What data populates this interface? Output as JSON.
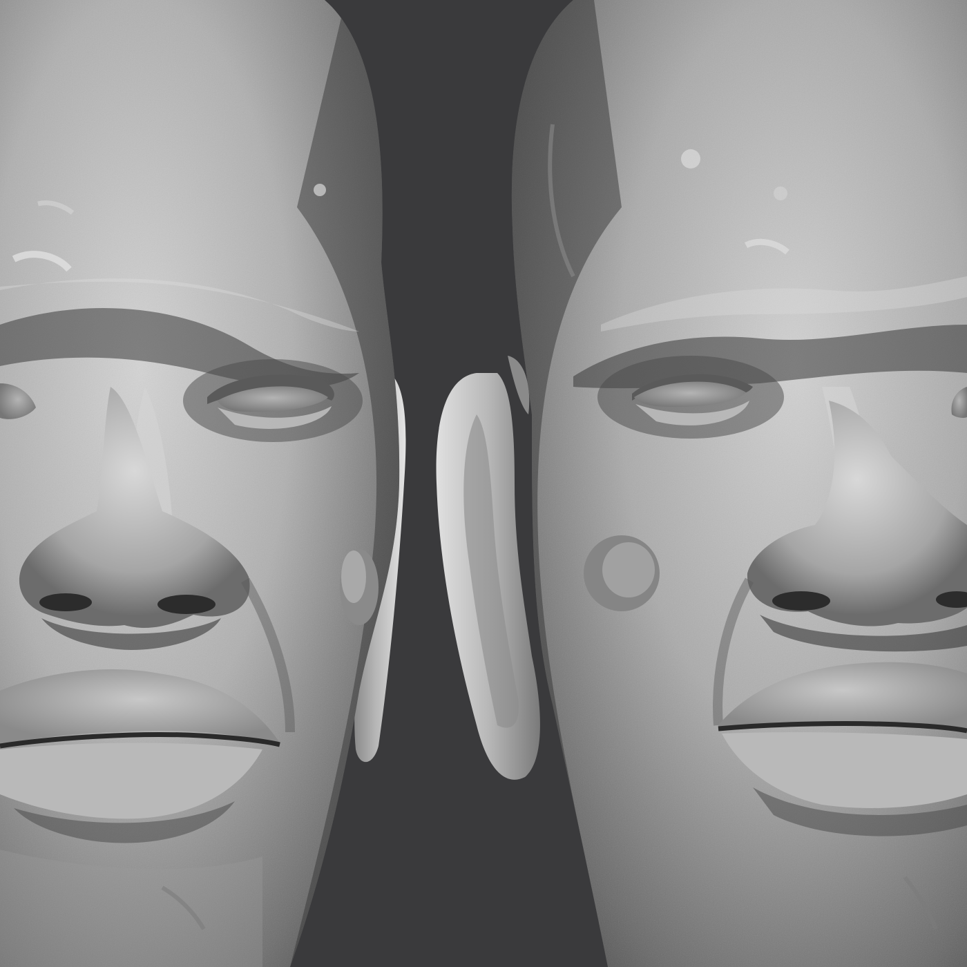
{
  "scene": {
    "subject_count": 2,
    "colors": {
      "background": "#3a3a3c",
      "clay_light": "#d2d2d2",
      "clay_mid": "#9c9c9c",
      "clay_dark": "#4a4a4a",
      "shadow": "#1e1e1e"
    }
  }
}
